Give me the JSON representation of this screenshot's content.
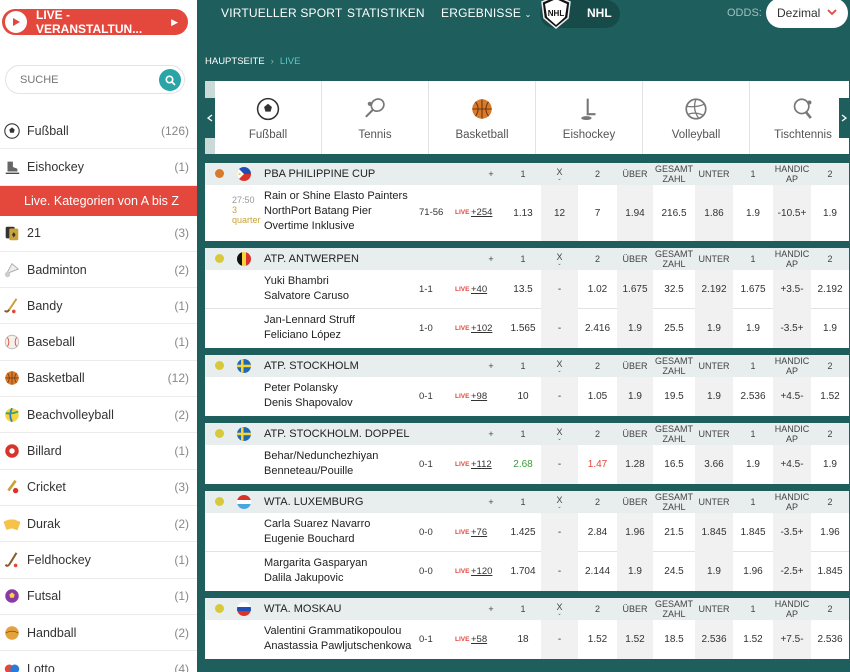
{
  "sidebar": {
    "live_button": "LIVE -VERANSTALTUN...",
    "search_placeholder": "SUCHE",
    "top_items": [
      {
        "label": "Fußball",
        "count": "(126)",
        "icon": "soccer-ball-icon"
      },
      {
        "label": "Eishockey",
        "count": "(1)",
        "icon": "ice-skate-icon"
      }
    ],
    "category_banner": "Live. Kategorien von A bis Z",
    "items": [
      {
        "label": "21",
        "count": "(3)",
        "icon": "cards-icon"
      },
      {
        "label": "Badminton",
        "count": "(2)",
        "icon": "shuttlecock-icon"
      },
      {
        "label": "Bandy",
        "count": "(1)",
        "icon": "bandy-stick-icon"
      },
      {
        "label": "Baseball",
        "count": "(1)",
        "icon": "baseball-icon"
      },
      {
        "label": "Basketball",
        "count": "(12)",
        "icon": "basketball-icon"
      },
      {
        "label": "Beachvolleyball",
        "count": "(2)",
        "icon": "beachvolleyball-icon"
      },
      {
        "label": "Billard",
        "count": "(1)",
        "icon": "billiard-ball-icon"
      },
      {
        "label": "Cricket",
        "count": "(3)",
        "icon": "cricket-icon"
      },
      {
        "label": "Durak",
        "count": "(2)",
        "icon": "durak-cards-icon"
      },
      {
        "label": "Feldhockey",
        "count": "(1)",
        "icon": "field-hockey-icon"
      },
      {
        "label": "Futsal",
        "count": "(1)",
        "icon": "futsal-ball-icon"
      },
      {
        "label": "Handball",
        "count": "(2)",
        "icon": "handball-icon"
      },
      {
        "label": "Lotto",
        "count": "(4)",
        "icon": "lotto-icon"
      }
    ]
  },
  "topnav": {
    "items": [
      "VIRTUELLER SPORT",
      "STATISTIKEN",
      "ERGEBNISSE"
    ],
    "nhl": "NHL",
    "odds_label": "ODDS:",
    "odds_value": "Dezimal"
  },
  "breadcrumb": {
    "home": "HAUPTSEITE",
    "current": "LIVE"
  },
  "sport_tabs": [
    {
      "label": "Fußball",
      "icon": "soccer-ball-icon"
    },
    {
      "label": "Tennis",
      "icon": "tennis-racket-icon"
    },
    {
      "label": "Basketball",
      "icon": "basketball-icon"
    },
    {
      "label": "Eishockey",
      "icon": "hockey-stick-icon"
    },
    {
      "label": "Volleyball",
      "icon": "volleyball-icon"
    },
    {
      "label": "Tischtennis",
      "icon": "table-tennis-icon"
    }
  ],
  "columns": {
    "plus": "+",
    "one": "1",
    "x": "X",
    "two": "2",
    "over": "ÜBER",
    "total": "GESAMT ZAHL",
    "under": "UNTER",
    "h1": "1",
    "handicap": "HANDIC AP",
    "h2": "2"
  },
  "leagues": [
    {
      "name": "PBA PHILIPPINE CUP",
      "sport": "basketball",
      "flag": "ph",
      "matches": [
        {
          "time": "27:50",
          "period": "3",
          "period_label": "quarter",
          "teams": [
            "Rain or Shine Elasto Painters",
            "NorthPort Batang Pier",
            "Overtime Inklusive"
          ],
          "score": "71-56",
          "live": "LIVE",
          "more": "+254",
          "odds": [
            "1.13",
            "12",
            "7",
            "1.94",
            "216.5",
            "1.86",
            "1.9",
            "-10.5+",
            "1.9"
          ]
        }
      ]
    },
    {
      "name": "ATP. ANTWERPEN",
      "sport": "tennis",
      "flag": "be",
      "matches": [
        {
          "teams": [
            "Yuki Bhambri",
            "Salvatore Caruso"
          ],
          "score": "1-1",
          "live": "LIVE",
          "more": "+40",
          "odds": [
            "13.5",
            "-",
            "1.02",
            "1.675",
            "32.5",
            "2.192",
            "1.675",
            "+3.5-",
            "2.192"
          ]
        },
        {
          "teams": [
            "Jan-Lennard Struff",
            "Feliciano López"
          ],
          "score": "1-0",
          "live": "LIVE",
          "more": "+102",
          "odds": [
            "1.565",
            "-",
            "2.416",
            "1.9",
            "25.5",
            "1.9",
            "1.9",
            "-3.5+",
            "1.9"
          ]
        }
      ]
    },
    {
      "name": "ATP. STOCKHOLM",
      "sport": "tennis",
      "flag": "se",
      "matches": [
        {
          "teams": [
            "Peter Polansky",
            "Denis Shapovalov"
          ],
          "score": "0-1",
          "live": "LIVE",
          "more": "+98",
          "odds": [
            "10",
            "-",
            "1.05",
            "1.9",
            "19.5",
            "1.9",
            "2.536",
            "+4.5-",
            "1.52"
          ]
        }
      ]
    },
    {
      "name": "ATP. STOCKHOLM. DOPPEL",
      "sport": "tennis",
      "flag": "se",
      "matches": [
        {
          "teams": [
            "Behar/Nedunchezhiyan",
            "Benneteau/Pouille"
          ],
          "score": "0-1",
          "live": "LIVE",
          "more": "+112",
          "odds": [
            "2.68",
            "-",
            "1.47",
            "1.28",
            "16.5",
            "3.66",
            "1.9",
            "+4.5-",
            "1.9"
          ]
        }
      ]
    },
    {
      "name": "WTA. LUXEMBURG",
      "sport": "tennis",
      "flag": "lu",
      "matches": [
        {
          "teams": [
            "Carla Suarez Navarro",
            "Eugenie Bouchard"
          ],
          "score": "0-0",
          "live": "LIVE",
          "more": "+76",
          "odds": [
            "1.425",
            "-",
            "2.84",
            "1.96",
            "21.5",
            "1.845",
            "1.845",
            "-3.5+",
            "1.96"
          ]
        },
        {
          "teams": [
            "Margarita Gasparyan",
            "Dalila Jakupovic"
          ],
          "score": "0-0",
          "live": "LIVE",
          "more": "+120",
          "odds": [
            "1.704",
            "-",
            "2.144",
            "1.9",
            "24.5",
            "1.9",
            "1.96",
            "-2.5+",
            "1.845"
          ]
        }
      ]
    },
    {
      "name": "WTA. MOSKAU",
      "sport": "tennis",
      "flag": "ru",
      "matches": [
        {
          "teams": [
            "Valentini Grammatikopoulou",
            "Anastassia Pawljutschenkowa"
          ],
          "score": "0-1",
          "live": "LIVE",
          "more": "+58",
          "odds": [
            "18",
            "-",
            "1.52",
            "1.52",
            "18.5",
            "2.536",
            "1.52",
            "+7.5-",
            "2.536"
          ]
        }
      ]
    }
  ],
  "colors": {
    "accent_red": "#e4473b",
    "brand_teal": "#1e5e5d",
    "search_teal": "#2aa5a7",
    "odd_up": "#3c9a3c",
    "odd_down": "#e4473b"
  }
}
